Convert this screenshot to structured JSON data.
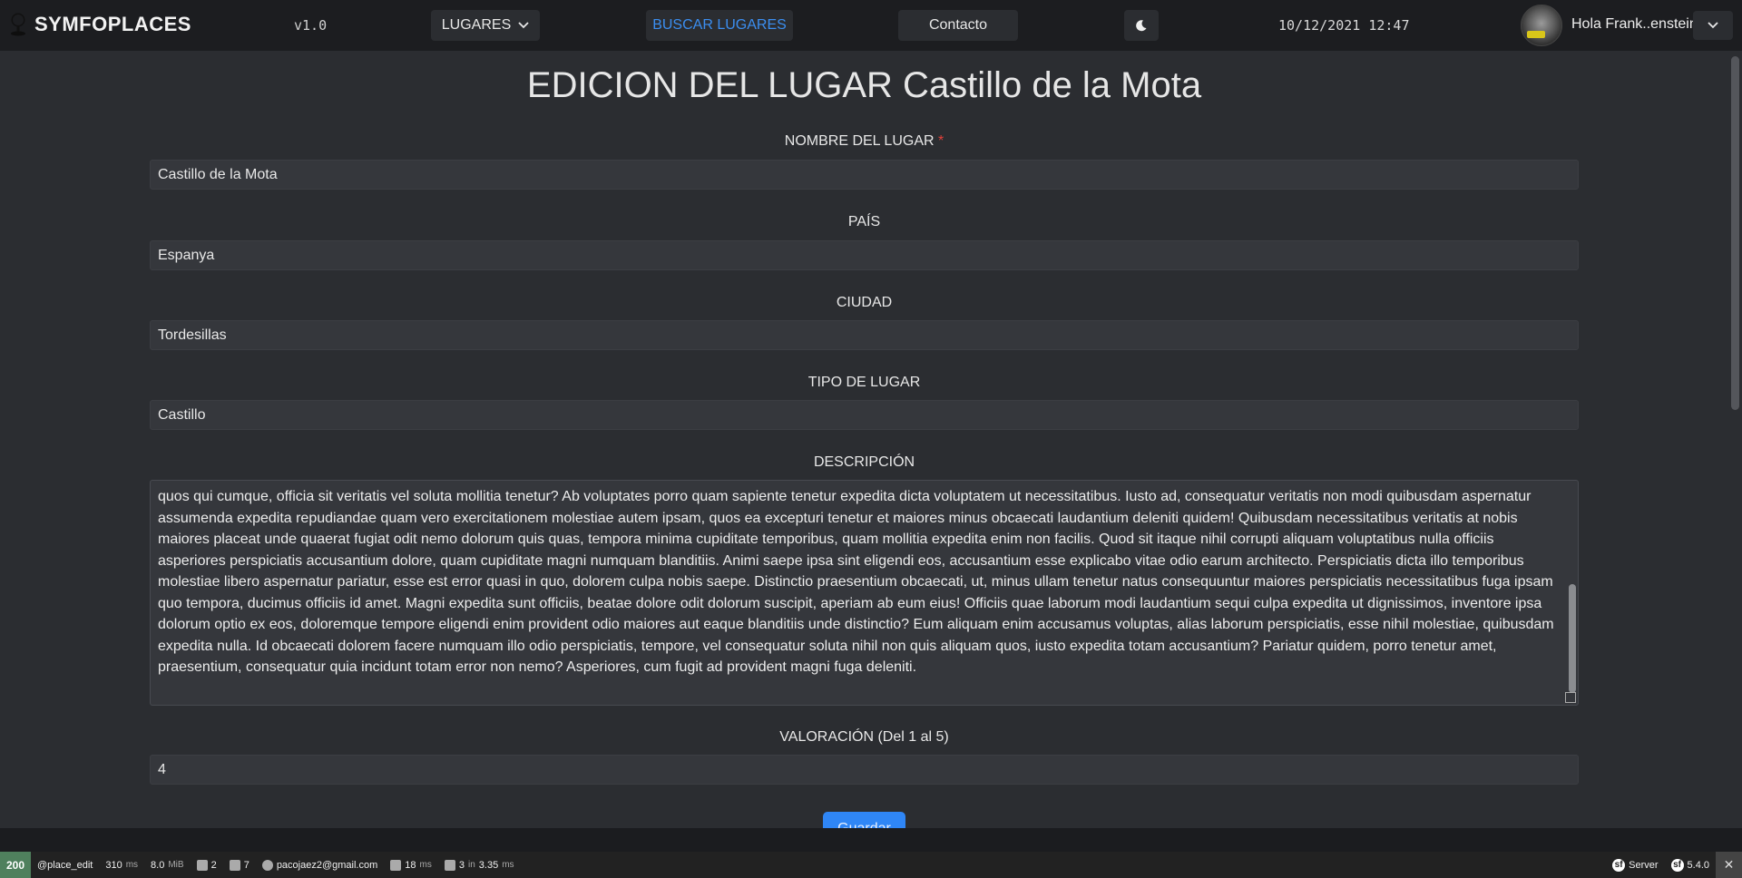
{
  "navbar": {
    "brand": "SYMFOPLACES",
    "version": "v1.0",
    "lugares_label": "LUGARES",
    "buscar_label": "BUSCAR LUGARES",
    "contacto_label": "Contacto",
    "datetime": "10/12/2021 12:47",
    "user_greeting": "Hola Frank..enstein",
    "theme_icon": "moon-icon",
    "accent": "#3b8ef0"
  },
  "form": {
    "title": "EDICION DEL LUGAR Castillo de la Mota",
    "nombre_label": "NOMBRE DEL LUGAR",
    "required_mark": "*",
    "nombre_value": "Castillo de la Mota",
    "pais_label": "PAÍS",
    "pais_value": "Espanya",
    "ciudad_label": "CIUDAD",
    "ciudad_value": "Tordesillas",
    "tipo_label": "TIPO DE LUGAR",
    "tipo_value": "Castillo",
    "descripcion_label": "DESCRIPCIÓN",
    "descripcion_value": "quos qui cumque, officia sit veritatis vel soluta mollitia tenetur? Ab voluptates porro quam sapiente tenetur expedita dicta voluptatem ut necessitatibus. Iusto ad, consequatur veritatis non modi quibusdam aspernatur assumenda expedita repudiandae quam vero exercitationem molestiae autem ipsam, quos ea excepturi tenetur et maiores minus obcaecati laudantium deleniti quidem! Quibusdam necessitatibus veritatis at nobis maiores placeat unde quaerat fugiat odit nemo dolorum quis quas, tempora minima cupiditate temporibus, quam mollitia expedita enim non facilis. Quod sit itaque nihil corrupti aliquam voluptatibus nulla officiis asperiores perspiciatis accusantium dolore, quam cupiditate magni numquam blanditiis. Animi saepe ipsa sint eligendi eos, accusantium esse explicabo vitae odio earum architecto. Perspiciatis dicta illo temporibus molestiae libero aspernatur pariatur, esse est error quasi in quo, dolorem culpa nobis saepe. Distinctio praesentium obcaecati, ut, minus ullam tenetur natus consequuntur maiores perspiciatis necessitatibus fuga ipsam quo tempora, ducimus officiis id amet. Magni expedita sunt officiis, beatae dolore odit dolorum suscipit, aperiam ab eum eius! Officiis quae laborum modi laudantium sequi culpa expedita ut dignissimos, inventore ipsa dolorum optio ex eos, doloremque tempore eligendi enim provident odio maiores aut eaque blanditiis unde distinctio? Eum aliquam enim accusamus voluptas, alias laborum perspiciatis, esse nihil molestiae, quibusdam expedita nulla. Id obcaecati dolorem facere numquam illo odio perspiciatis, tempore, vel consequatur soluta nihil non quis aliquam quos, iusto expedita totam accusantium? Pariatur quidem, porro tenetur amet, praesentium, consequatur quia incidunt totam error non nemo? Asperiores, cum fugit ad provident magni fuga deleniti.",
    "valoracion_label": "VALORACIÓN (Del 1 al 5)",
    "valoracion_value": "4",
    "save_label": "Guardar"
  },
  "sf_toolbar": {
    "status": "200",
    "route": "@place_edit",
    "time": "310",
    "time_unit": "ms",
    "memory": "8.0",
    "memory_unit": "MiB",
    "forms": "2",
    "validator": "7",
    "user": "pacojaez2@gmail.com",
    "twig_time": "18",
    "twig_unit": "ms",
    "db_queries": "3",
    "db_in": "in",
    "db_time": "3.35",
    "db_unit": "ms",
    "server_label": "Server",
    "symfony_version": "5.4.0",
    "status_color": "#4f805d"
  }
}
